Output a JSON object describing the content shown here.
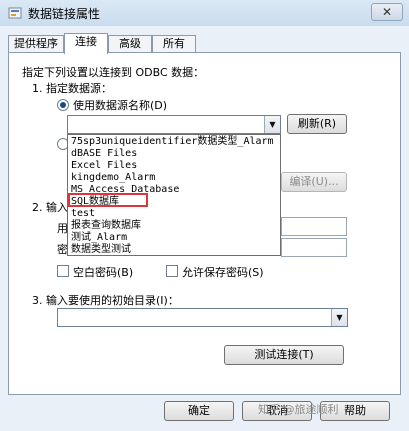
{
  "window": {
    "title": "数据链接属性",
    "close": "✕"
  },
  "tabs": [
    "提供程序",
    "连接",
    "高级",
    "所有"
  ],
  "connection": {
    "intro": "指定下列设置以连接到 ODBC 数据：",
    "step1": "1. 指定数据源：",
    "use_dsn": "使用数据源名称(D)",
    "refresh": "刷新(R)",
    "compile": "编译(U)...",
    "step2_prefix": "2. 输入",
    "user_prefix": "用户",
    "password_prefix": "密",
    "blank_password": "空白密码(B)",
    "allow_save_password": "允许保存密码(S)",
    "step3": "3. 输入要使用的初始目录(I)：",
    "test_connection": "测试连接(T)"
  },
  "dsn_list": [
    "75sp3uniqueidentifier数据类型_Alarm",
    "dBASE Files",
    "Excel Files",
    "kingdemo_Alarm",
    "MS Access Database",
    "SQL数据库",
    "test",
    "报表查询数据库",
    "测试_Alarm",
    "数据类型测试"
  ],
  "footer": {
    "ok": "确定",
    "cancel": "取消",
    "help": "帮助"
  },
  "watermark": "知乎 @旅途顺利"
}
